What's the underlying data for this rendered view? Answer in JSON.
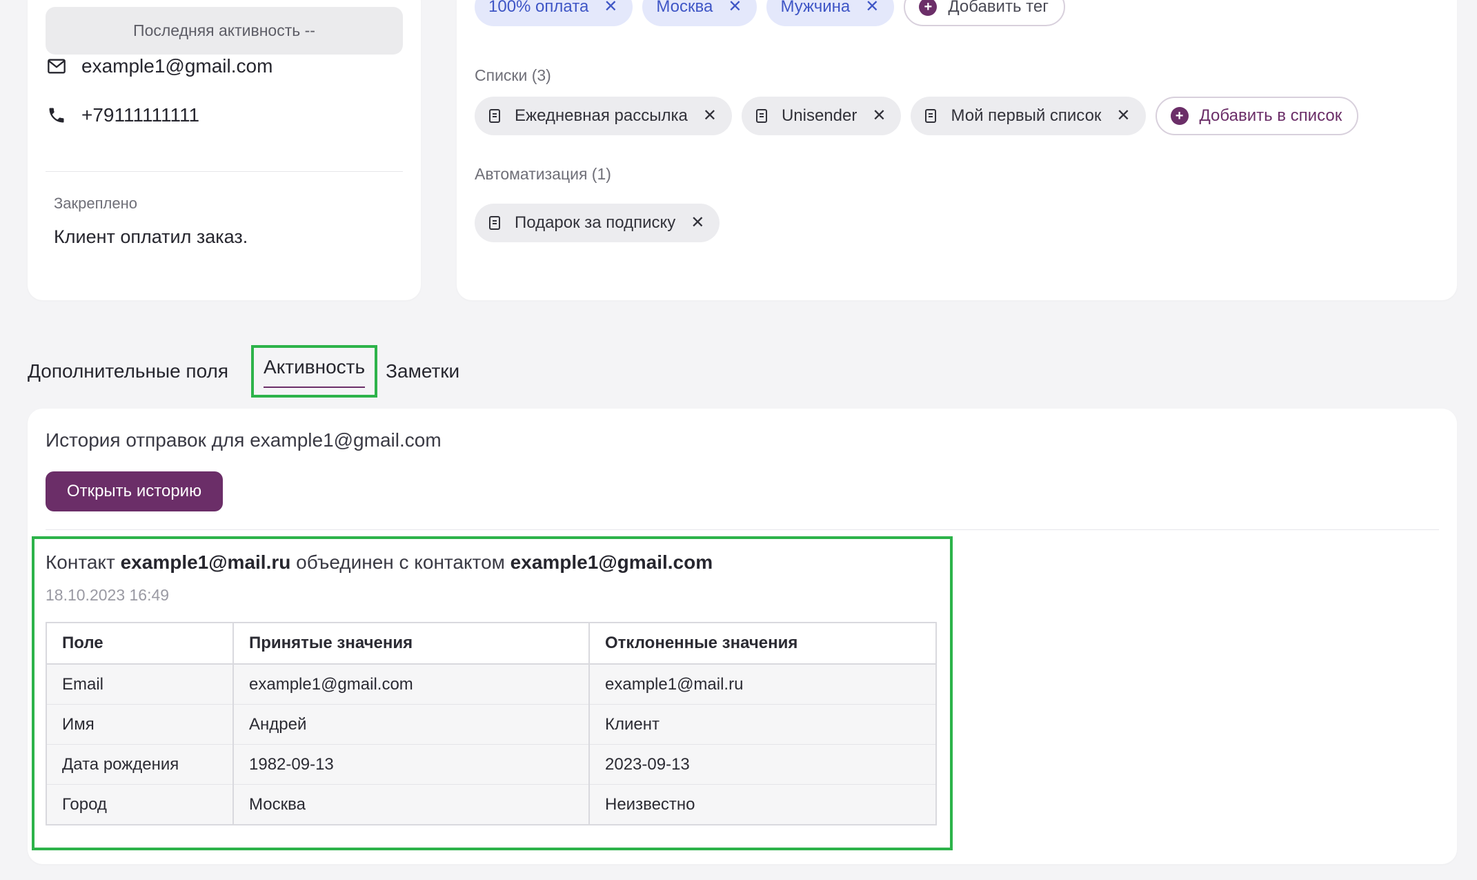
{
  "profile": {
    "last_activity": "Последняя активность --",
    "email": "example1@gmail.com",
    "phone": "+79111111111",
    "pinned_label": "Закреплено",
    "pinned_text": "Клиент оплатил заказ."
  },
  "tags": {
    "items": [
      "100% оплата",
      "Москва",
      "Мужчина"
    ],
    "add_label": "Добавить тег"
  },
  "lists": {
    "label": "Списки (3)",
    "items": [
      "Ежедневная рассылка",
      "Unisender",
      "Мой первый список"
    ],
    "add_label": "Добавить в список"
  },
  "automation": {
    "label": "Автоматизация (1)",
    "items": [
      "Подарок за подписку"
    ]
  },
  "tabs": {
    "fields": "Дополнительные поля",
    "activity": "Активность",
    "notes": "Заметки",
    "active": "activity"
  },
  "history": {
    "title": "История отправок для example1@gmail.com",
    "button": "Открыть историю"
  },
  "merge": {
    "prefix": "Контакт ",
    "source": "example1@mail.ru",
    "middle": " объединен с контактом ",
    "target": "example1@gmail.com",
    "date": "18.10.2023 16:49",
    "columns": [
      "Поле",
      "Принятые значения",
      "Отклоненные значения"
    ],
    "rows": [
      [
        "Email",
        "example1@gmail.com",
        "example1@mail.ru"
      ],
      [
        "Имя",
        "Андрей",
        "Клиент"
      ],
      [
        "Дата рождения",
        "1982-09-13",
        "2023-09-13"
      ],
      [
        "Город",
        "Москва",
        "Неизвестно"
      ]
    ]
  },
  "colors": {
    "accent": "#6b2e68",
    "highlight": "#2db34a",
    "tag_bg": "#e4e8fb",
    "tag_text": "#3f56c6"
  },
  "icons": {
    "email": "envelope-icon",
    "phone": "phone-icon",
    "list": "document-icon",
    "remove": "close-icon",
    "add": "plus-circle-icon"
  }
}
